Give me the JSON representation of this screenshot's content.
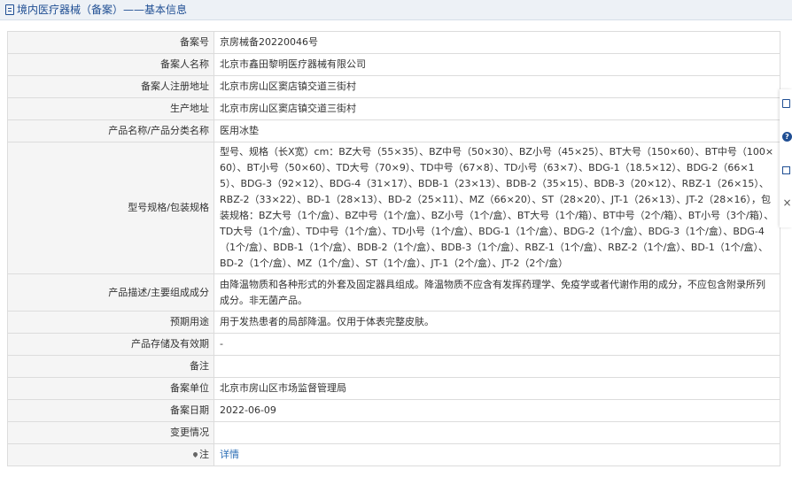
{
  "header": {
    "title": "境内医疗器械（备案）——基本信息"
  },
  "rows": [
    {
      "label": "备案号",
      "value": "京房械备20220046号"
    },
    {
      "label": "备案人名称",
      "value": "北京市鑫田黎明医疗器械有限公司"
    },
    {
      "label": "备案人注册地址",
      "value": "北京市房山区窦店镇交道三街村"
    },
    {
      "label": "生产地址",
      "value": "北京市房山区窦店镇交道三街村"
    },
    {
      "label": "产品名称/产品分类名称",
      "value": "医用冰垫"
    },
    {
      "label": "型号规格/包装规格",
      "value": "型号、规格（长X宽）cm：BZ大号（55×35）、BZ中号（50×30）、BZ小号（45×25）、BT大号（150×60）、BT中号（100×60）、BT小号（50×60）、TD大号（70×9）、TD中号（67×8）、TD小号（63×7）、BDG-1（18.5×12）、BDG-2（66×15）、BDG-3（92×12）、BDG-4（31×17）、BDB-1（23×13）、BDB-2（35×15）、BDB-3（20×12）、RBZ-1（26×15）、RBZ-2（33×22）、BD-1（28×13）、BD-2（25×11）、MZ（66×20）、ST（28×20）、JT-1（26×13）、JT-2（28×16），包装规格：BZ大号（1个/盒）、BZ中号（1个/盒）、BZ小号（1个/盒）、BT大号（1个/箱）、BT中号（2个/箱）、BT小号（3个/箱）、TD大号（1个/盒）、TD中号（1个/盒）、TD小号（1个/盒）、BDG-1（1个/盒）、BDG-2（1个/盒）、BDG-3（1个/盒）、BDG-4（1个/盒）、BDB-1（1个/盒）、BDB-2（1个/盒）、BDB-3（1个/盒）、RBZ-1（1个/盒）、RBZ-2（1个/盒）、BD-1（1个/盒）、BD-2（1个/盒）、MZ（1个/盒）、ST（1个/盒）、JT-1（2个/盒）、JT-2（2个/盒）"
    },
    {
      "label": "产品描述/主要组成成分",
      "value": "由降温物质和各种形式的外套及固定器具组成。降温物质不应含有发挥药理学、免疫学或者代谢作用的成分，不应包含附录所列成分。非无菌产品。"
    },
    {
      "label": "预期用途",
      "value": "用于发热患者的局部降温。仅用于体表完整皮肤。"
    },
    {
      "label": "产品存储及有效期",
      "value": "-"
    },
    {
      "label": "备注",
      "value": ""
    },
    {
      "label": "备案单位",
      "value": "北京市房山区市场监督管理局"
    },
    {
      "label": "备案日期",
      "value": "2022-06-09"
    },
    {
      "label": "变更情况",
      "value": ""
    }
  ],
  "note": {
    "label": "注",
    "link": "详情"
  },
  "side_tools": {
    "help_glyph": "?",
    "close_glyph": "×"
  },
  "colors": {
    "accent": "#1f4e93",
    "link": "#2a6db5",
    "label_bg": "#f5f5f5",
    "border": "#dcdcdc"
  }
}
